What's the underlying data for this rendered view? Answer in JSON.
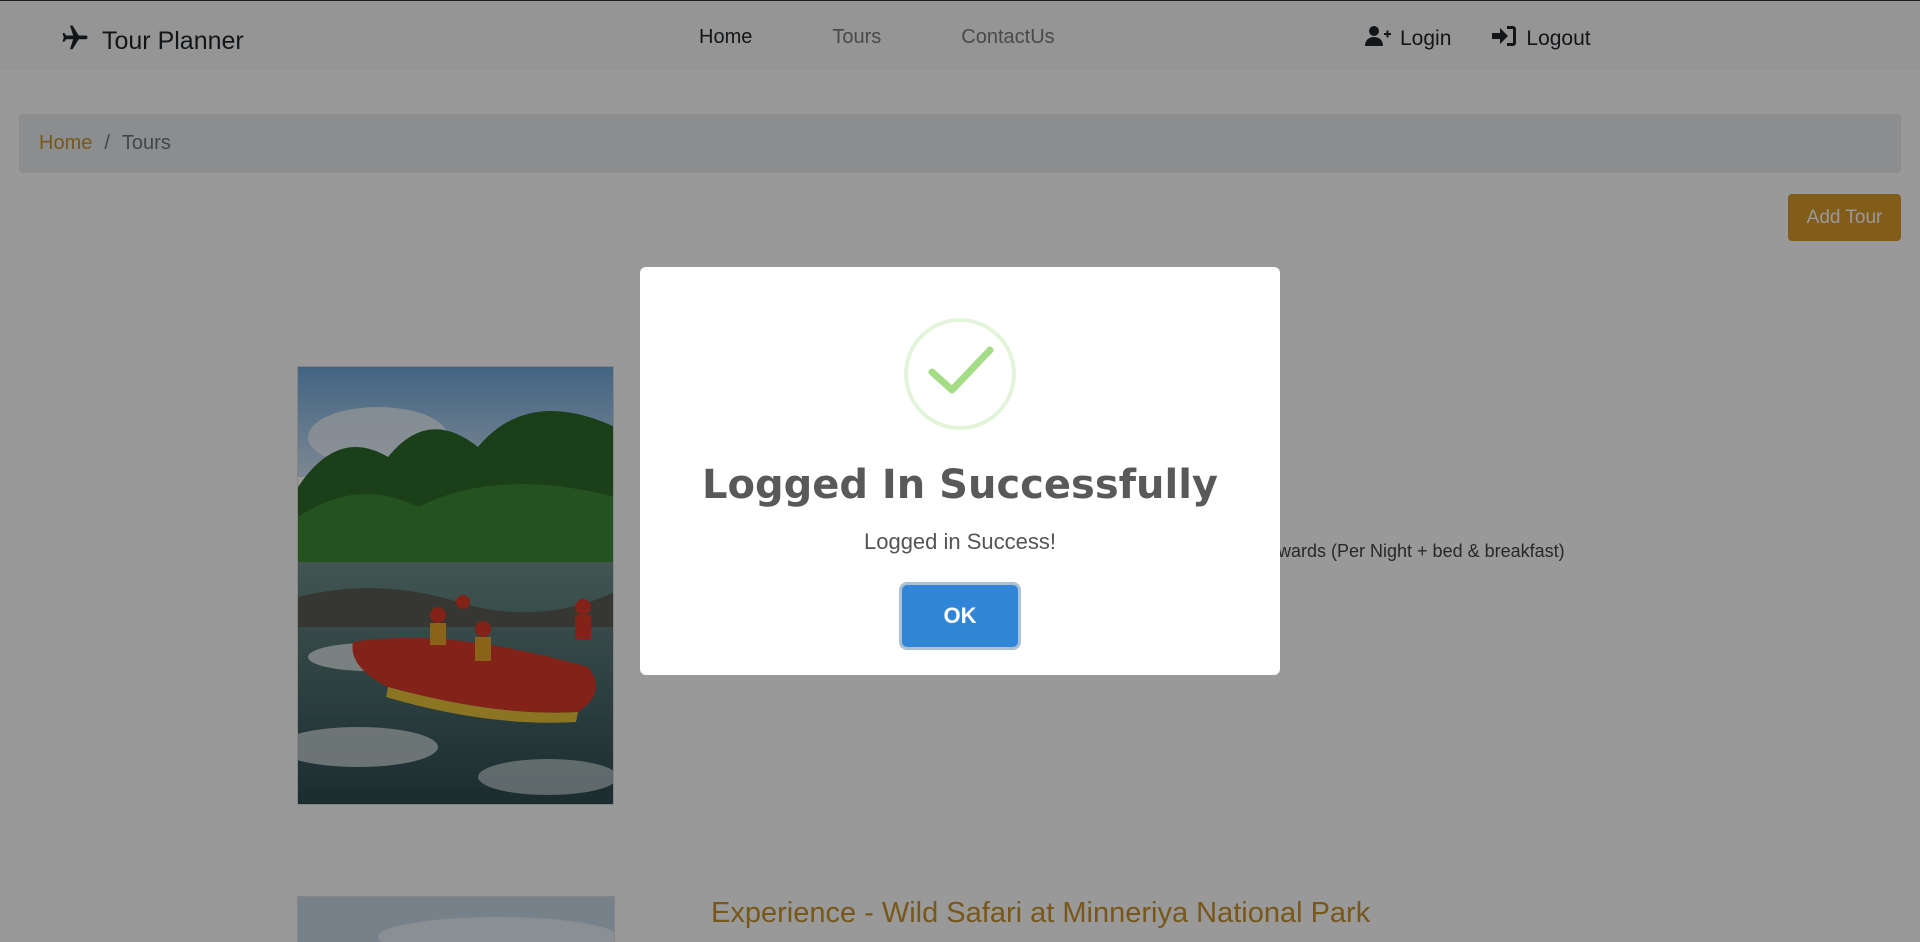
{
  "navbar": {
    "brand": "Tour Planner",
    "links": {
      "home": "Home",
      "tours": "Tours",
      "contact": "ContactUs"
    },
    "login": "Login",
    "logout": "Logout"
  },
  "breadcrumb": {
    "home": "Home",
    "separator": "/",
    "current": "Tours"
  },
  "actions": {
    "add_tour": "Add Tour"
  },
  "tours": {
    "first_description_fragment": "wards (Per Night + bed & breakfast)",
    "second_title": "Experience - Wild Safari at Minneriya National Park"
  },
  "modal": {
    "title": "Logged In Successfully",
    "text": "Logged in Success!",
    "ok_label": "OK"
  },
  "colors": {
    "accent": "#d99a2b",
    "link": "#c8922c",
    "ok_button": "#3085d6",
    "success": "#a5dc86"
  }
}
